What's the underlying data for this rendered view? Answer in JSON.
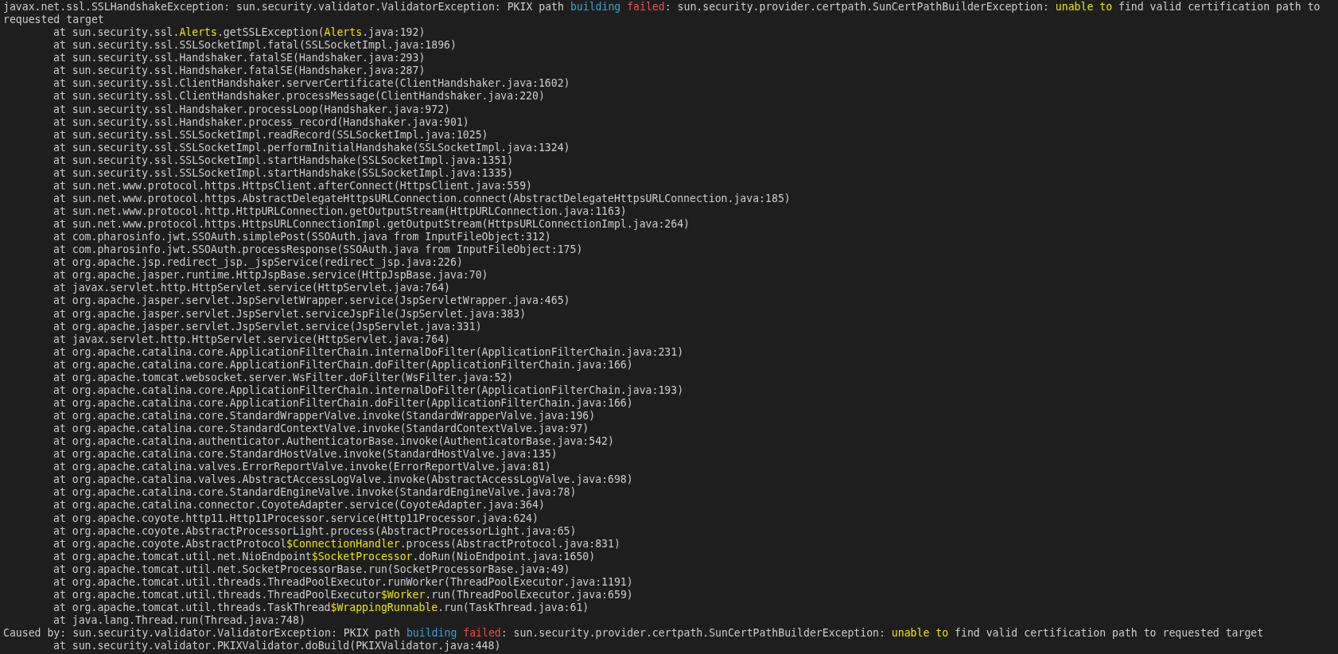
{
  "terminal": {
    "lines": [
      {
        "kind": "exception",
        "segments": [
          {
            "text": "javax.net.ssl.SSLHandshakeException: sun.security.validator.ValidatorException: PKIX path ",
            "kind": "plain"
          },
          {
            "text": "building ",
            "kind": "keyword"
          },
          {
            "text": "failed",
            "kind": "error"
          },
          {
            "text": ": sun.security.provider.certpath.SunCertPathBuilderException: ",
            "kind": "plain"
          },
          {
            "text": "unable to",
            "kind": "highlight"
          },
          {
            "text": " find valid certification path to requested target",
            "kind": "plain"
          }
        ]
      },
      {
        "kind": "frame",
        "segments": [
          {
            "text": "at sun.security.ssl.",
            "kind": "plain"
          },
          {
            "text": "Alerts",
            "kind": "highlight"
          },
          {
            "text": ".getSSLException(",
            "kind": "plain"
          },
          {
            "text": "Alerts",
            "kind": "highlight"
          },
          {
            "text": ".java:192)",
            "kind": "plain"
          }
        ]
      },
      {
        "kind": "frame",
        "text": "at sun.security.ssl.SSLSocketImpl.fatal(SSLSocketImpl.java:1896)"
      },
      {
        "kind": "frame",
        "text": "at sun.security.ssl.Handshaker.fatalSE(Handshaker.java:293)"
      },
      {
        "kind": "frame",
        "text": "at sun.security.ssl.Handshaker.fatalSE(Handshaker.java:287)"
      },
      {
        "kind": "frame",
        "text": "at sun.security.ssl.ClientHandshaker.serverCertificate(ClientHandshaker.java:1602)"
      },
      {
        "kind": "frame",
        "text": "at sun.security.ssl.ClientHandshaker.processMessage(ClientHandshaker.java:220)"
      },
      {
        "kind": "frame",
        "text": "at sun.security.ssl.Handshaker.processLoop(Handshaker.java:972)"
      },
      {
        "kind": "frame",
        "text": "at sun.security.ssl.Handshaker.process_record(Handshaker.java:901)"
      },
      {
        "kind": "frame",
        "text": "at sun.security.ssl.SSLSocketImpl.readRecord(SSLSocketImpl.java:1025)"
      },
      {
        "kind": "frame",
        "text": "at sun.security.ssl.SSLSocketImpl.performInitialHandshake(SSLSocketImpl.java:1324)"
      },
      {
        "kind": "frame",
        "text": "at sun.security.ssl.SSLSocketImpl.startHandshake(SSLSocketImpl.java:1351)"
      },
      {
        "kind": "frame",
        "text": "at sun.security.ssl.SSLSocketImpl.startHandshake(SSLSocketImpl.java:1335)"
      },
      {
        "kind": "frame",
        "text": "at sun.net.www.protocol.https.HttpsClient.afterConnect(HttpsClient.java:559)"
      },
      {
        "kind": "frame",
        "text": "at sun.net.www.protocol.https.AbstractDelegateHttpsURLConnection.connect(AbstractDelegateHttpsURLConnection.java:185)"
      },
      {
        "kind": "frame",
        "text": "at sun.net.www.protocol.http.HttpURLConnection.getOutputStream(HttpURLConnection.java:1163)"
      },
      {
        "kind": "frame",
        "text": "at sun.net.www.protocol.https.HttpsURLConnectionImpl.getOutputStream(HttpsURLConnectionImpl.java:264)"
      },
      {
        "kind": "frame",
        "text": "at com.pharosinfo.jwt.SSOAuth.simplePost(SSOAuth.java from InputFileObject:312)"
      },
      {
        "kind": "frame",
        "text": "at com.pharosinfo.jwt.SSOAuth.processResponse(SSOAuth.java from InputFileObject:175)"
      },
      {
        "kind": "frame",
        "text": "at org.apache.jsp.redirect_jsp._jspService(redirect_jsp.java:226)"
      },
      {
        "kind": "frame",
        "text": "at org.apache.jasper.runtime.HttpJspBase.service(HttpJspBase.java:70)"
      },
      {
        "kind": "frame",
        "text": "at javax.servlet.http.HttpServlet.service(HttpServlet.java:764)"
      },
      {
        "kind": "frame",
        "text": "at org.apache.jasper.servlet.JspServletWrapper.service(JspServletWrapper.java:465)"
      },
      {
        "kind": "frame",
        "text": "at org.apache.jasper.servlet.JspServlet.serviceJspFile(JspServlet.java:383)"
      },
      {
        "kind": "frame",
        "text": "at org.apache.jasper.servlet.JspServlet.service(JspServlet.java:331)"
      },
      {
        "kind": "frame",
        "text": "at javax.servlet.http.HttpServlet.service(HttpServlet.java:764)"
      },
      {
        "kind": "frame",
        "text": "at org.apache.catalina.core.ApplicationFilterChain.internalDoFilter(ApplicationFilterChain.java:231)"
      },
      {
        "kind": "frame",
        "text": "at org.apache.catalina.core.ApplicationFilterChain.doFilter(ApplicationFilterChain.java:166)"
      },
      {
        "kind": "frame",
        "text": "at org.apache.tomcat.websocket.server.WsFilter.doFilter(WsFilter.java:52)"
      },
      {
        "kind": "frame",
        "text": "at org.apache.catalina.core.ApplicationFilterChain.internalDoFilter(ApplicationFilterChain.java:193)"
      },
      {
        "kind": "frame",
        "text": "at org.apache.catalina.core.ApplicationFilterChain.doFilter(ApplicationFilterChain.java:166)"
      },
      {
        "kind": "frame",
        "text": "at org.apache.catalina.core.StandardWrapperValve.invoke(StandardWrapperValve.java:196)"
      },
      {
        "kind": "frame",
        "text": "at org.apache.catalina.core.StandardContextValve.invoke(StandardContextValve.java:97)"
      },
      {
        "kind": "frame",
        "text": "at org.apache.catalina.authenticator.AuthenticatorBase.invoke(AuthenticatorBase.java:542)"
      },
      {
        "kind": "frame",
        "text": "at org.apache.catalina.core.StandardHostValve.invoke(StandardHostValve.java:135)"
      },
      {
        "kind": "frame",
        "text": "at org.apache.catalina.valves.ErrorReportValve.invoke(ErrorReportValve.java:81)"
      },
      {
        "kind": "frame",
        "text": "at org.apache.catalina.valves.AbstractAccessLogValve.invoke(AbstractAccessLogValve.java:698)"
      },
      {
        "kind": "frame",
        "text": "at org.apache.catalina.core.StandardEngineValve.invoke(StandardEngineValve.java:78)"
      },
      {
        "kind": "frame",
        "text": "at org.apache.catalina.connector.CoyoteAdapter.service(CoyoteAdapter.java:364)"
      },
      {
        "kind": "frame",
        "text": "at org.apache.coyote.http11.Http11Processor.service(Http11Processor.java:624)"
      },
      {
        "kind": "frame",
        "text": "at org.apache.coyote.AbstractProcessorLight.process(AbstractProcessorLight.java:65)"
      },
      {
        "kind": "frame",
        "segments": [
          {
            "text": "at org.apache.coyote.AbstractProtocol",
            "kind": "plain"
          },
          {
            "text": "$ConnectionHandler",
            "kind": "highlight"
          },
          {
            "text": ".process(AbstractProtocol.java:831)",
            "kind": "plain"
          }
        ]
      },
      {
        "kind": "frame",
        "segments": [
          {
            "text": "at org.apache.tomcat.util.net.NioEndpoint",
            "kind": "plain"
          },
          {
            "text": "$SocketProcessor",
            "kind": "highlight"
          },
          {
            "text": ".doRun(NioEndpoint.java:1650)",
            "kind": "plain"
          }
        ]
      },
      {
        "kind": "frame",
        "text": "at org.apache.tomcat.util.net.SocketProcessorBase.run(SocketProcessorBase.java:49)"
      },
      {
        "kind": "frame",
        "text": "at org.apache.tomcat.util.threads.ThreadPoolExecutor.runWorker(ThreadPoolExecutor.java:1191)"
      },
      {
        "kind": "frame",
        "segments": [
          {
            "text": "at org.apache.tomcat.util.threads.ThreadPoolExecutor",
            "kind": "plain"
          },
          {
            "text": "$Worker",
            "kind": "highlight"
          },
          {
            "text": ".run(ThreadPoolExecutor.java:659)",
            "kind": "plain"
          }
        ]
      },
      {
        "kind": "frame",
        "segments": [
          {
            "text": "at org.apache.tomcat.util.threads.TaskThread",
            "kind": "plain"
          },
          {
            "text": "$WrappingRunnable",
            "kind": "highlight"
          },
          {
            "text": ".run(TaskThread.java:61)",
            "kind": "plain"
          }
        ]
      },
      {
        "kind": "frame",
        "text": "at java.lang.Thread.run(Thread.java:748)"
      },
      {
        "kind": "exception",
        "segments": [
          {
            "text": "Caused by: sun.security.validator.ValidatorException: PKIX path ",
            "kind": "plain"
          },
          {
            "text": "building ",
            "kind": "keyword"
          },
          {
            "text": "failed",
            "kind": "error"
          },
          {
            "text": ": sun.security.provider.certpath.SunCertPathBuilderException: ",
            "kind": "plain"
          },
          {
            "text": "unable to",
            "kind": "highlight"
          },
          {
            "text": " find valid certification path to requested target",
            "kind": "plain"
          }
        ]
      },
      {
        "kind": "frame",
        "text": "at sun.security.validator.PKIXValidator.doBuild(PKIXValidator.java:448)"
      }
    ]
  }
}
